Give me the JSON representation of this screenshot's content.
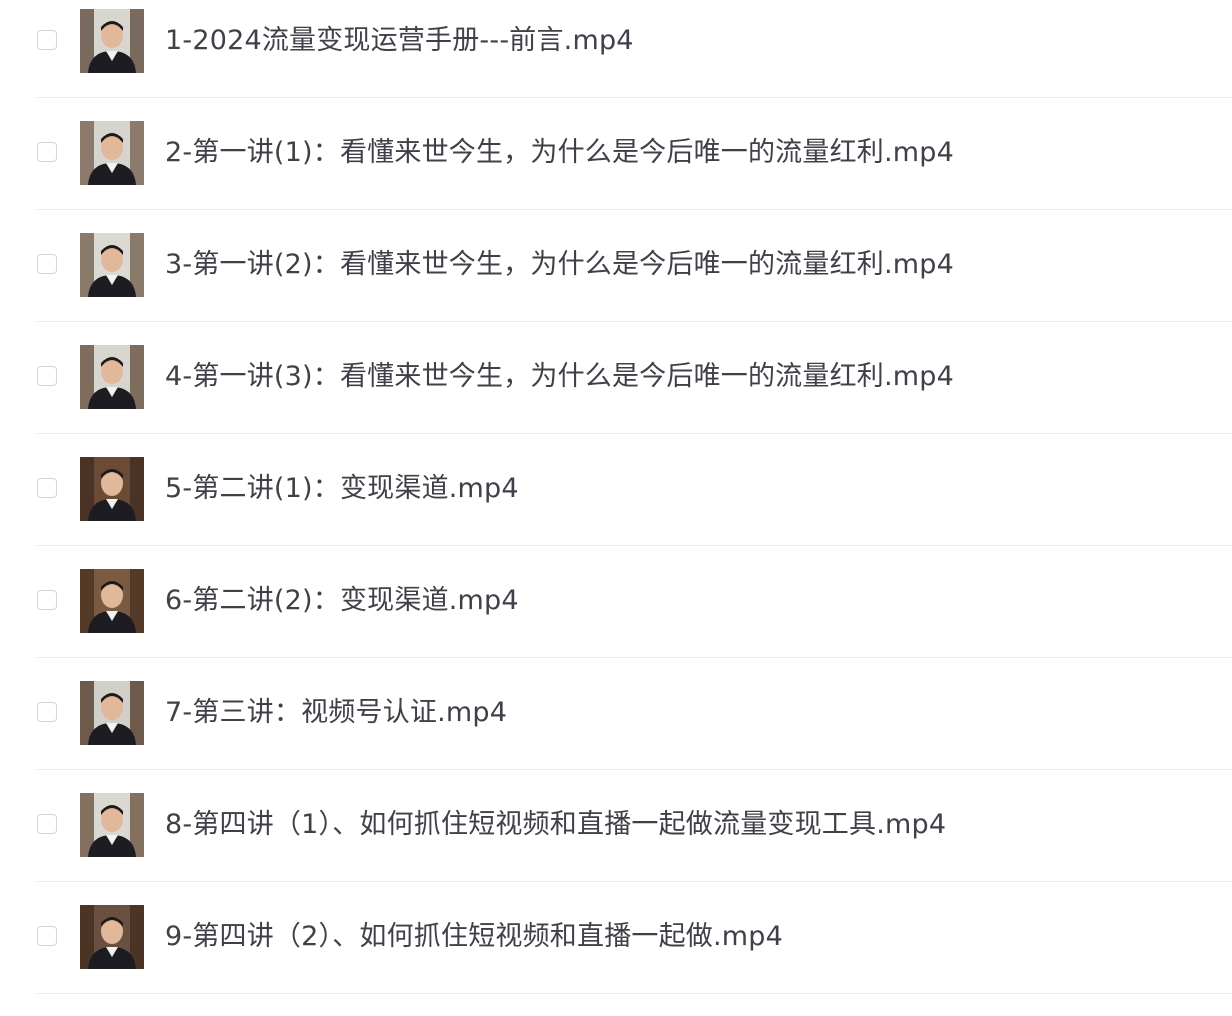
{
  "files": [
    {
      "name": "1-2024流量变现运营手册---前言.mp4",
      "thumb_bg": "#d9d5cf",
      "thumb_wall": "#7a6a5e"
    },
    {
      "name": "2-第一讲(1)：看懂来世今生，为什么是今后唯一的流量红利.mp4",
      "thumb_bg": "#d7d4cf",
      "thumb_wall": "#8c7b6c"
    },
    {
      "name": "3-第一讲(2)：看懂来世今生，为什么是今后唯一的流量红利.mp4",
      "thumb_bg": "#dcd8d2",
      "thumb_wall": "#8a7a6a"
    },
    {
      "name": "4-第一讲(3)：看懂来世今生，为什么是今后唯一的流量红利.mp4",
      "thumb_bg": "#d8d4ce",
      "thumb_wall": "#7e6c5d"
    },
    {
      "name": "5-第二讲(1)：变现渠道.mp4",
      "thumb_bg": "#6b4a36",
      "thumb_wall": "#4a3224"
    },
    {
      "name": "6-第二讲(2)：变现渠道.mp4",
      "thumb_bg": "#7b5a42",
      "thumb_wall": "#553a28"
    },
    {
      "name": "7-第三讲：视频号认证.mp4",
      "thumb_bg": "#d2cec8",
      "thumb_wall": "#6e5a4a"
    },
    {
      "name": "8-第四讲（1）、如何抓住短视频和直播一起做流量变现工具.mp4",
      "thumb_bg": "#dbd7d1",
      "thumb_wall": "#84705e"
    },
    {
      "name": "9-第四讲（2）、如何抓住短视频和直播一起做.mp4",
      "thumb_bg": "#6a5040",
      "thumb_wall": "#4c3424"
    }
  ],
  "icons": {
    "checkbox": "checkbox-icon",
    "thumbnail": "video-thumbnail"
  },
  "colors": {
    "text": "#404048",
    "divider": "#eeeeee",
    "checkbox_border": "#d4d4d6"
  }
}
